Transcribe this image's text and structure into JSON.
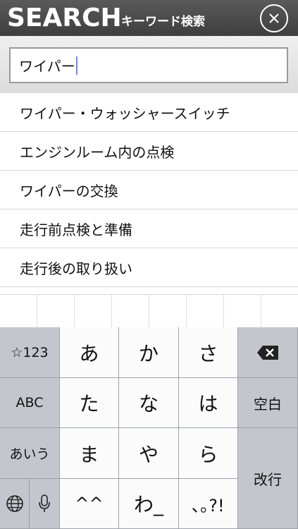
{
  "header": {
    "brand": "SEARCH",
    "subtitle": "キーワード検索"
  },
  "search": {
    "value": "ワイパー"
  },
  "suggestions": [
    "ワイパー・ウォッシャースイッチ",
    "エンジンルーム内の点検",
    "ワイパーの交換",
    "走行前点検と準備",
    "走行後の取り扱い"
  ],
  "keyboard": {
    "symbols_numbers": "☆123",
    "abc": "ABC",
    "aiu": "あいう",
    "row1": [
      "あ",
      "か",
      "さ"
    ],
    "row2": [
      "た",
      "な",
      "は"
    ],
    "row3": [
      "ま",
      "や",
      "ら"
    ],
    "row4": [
      "^^",
      "わ_",
      "､｡?!"
    ],
    "space": "空白",
    "return": "改行",
    "icons": {
      "backspace": "backspace-icon",
      "globe": "globe-icon",
      "mic": "microphone-icon",
      "close": "close-icon"
    }
  }
}
